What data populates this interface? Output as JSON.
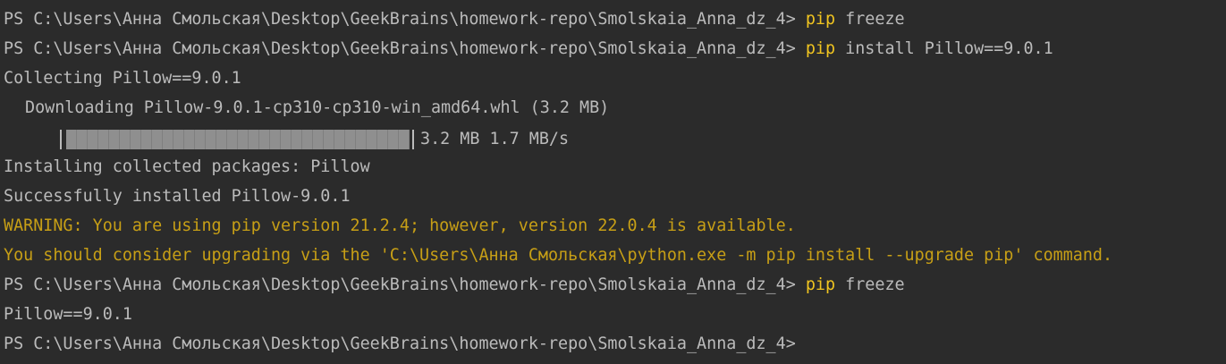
{
  "terminal": {
    "prompt": "PS C:\\Users\\Анна Смольская\\Desktop\\GeekBrains\\homework-repo\\Smolskaia_Anna_dz_4>",
    "lines": {
      "l1": {
        "cmd": "pip",
        "args": "freeze"
      },
      "l2": {
        "cmd": "pip",
        "args": "install Pillow==9.0.1"
      },
      "l3": "Collecting Pillow==9.0.1",
      "l4": "Downloading Pillow-9.0.1-cp310-cp310-win_amd64.whl (3.2 MB)",
      "progress": {
        "fraction": 1.0,
        "text": "3.2 MB 1.7 MB/s"
      },
      "l6": "Installing collected packages: Pillow",
      "l7": "Successfully installed Pillow-9.0.1",
      "l8": "WARNING: You are using pip version 21.2.4; however, version 22.0.4 is available.",
      "l9": "You should consider upgrading via the 'C:\\Users\\Анна Смольская\\python.exe -m pip install --upgrade pip' command.",
      "l10": {
        "cmd": "pip",
        "args": "freeze"
      },
      "l11": "Pillow==9.0.1"
    }
  },
  "colors": {
    "background": "#2b2b2b",
    "text": "#bbbbbb",
    "command": "#f0c420",
    "warning": "#c79f16"
  }
}
